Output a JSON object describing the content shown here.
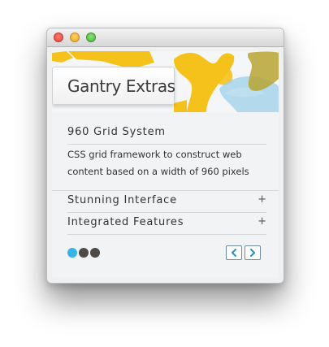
{
  "window": {
    "traffic_lights": [
      "close",
      "minimize",
      "zoom"
    ]
  },
  "widget": {
    "title": "Gantry Extras",
    "items": [
      {
        "label": "960 Grid System",
        "expanded": true,
        "description": "CSS grid framework to construct web content based on a width of 960 pixels"
      },
      {
        "label": "Stunning Interface",
        "expanded": false,
        "toggle": "+"
      },
      {
        "label": "Integrated Features",
        "expanded": false,
        "toggle": "+"
      }
    ],
    "pager": {
      "pages": 3,
      "active": 1
    },
    "nav": {
      "prev_icon": "chevron-left-icon",
      "next_icon": "chevron-right-icon"
    }
  },
  "colors": {
    "accent_blue": "#36b4e5",
    "inactive_dot": "#4d4a47",
    "banner_yellow": "#f5c21b",
    "banner_blue": "#9ccfe8",
    "banner_olive": "#b7a532"
  }
}
